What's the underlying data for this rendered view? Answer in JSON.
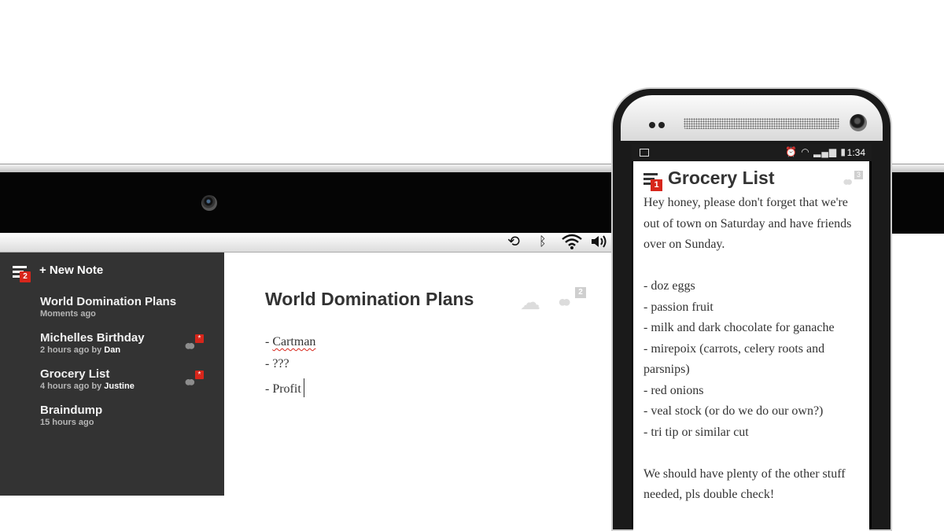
{
  "laptop": {
    "statusbar": {
      "icons": [
        "history-icon",
        "bluetooth-icon",
        "wifi-icon",
        "volume-icon"
      ]
    },
    "sidebar": {
      "unread_badge": "2",
      "new_note_label": "+ New Note",
      "notes": [
        {
          "title": "World Domination Plans",
          "meta": "Moments ago",
          "by": "",
          "name": "",
          "collab_badge": ""
        },
        {
          "title": "Michelles Birthday",
          "meta": "2 hours ago",
          "by": " by ",
          "name": "Dan",
          "collab_badge": "*"
        },
        {
          "title": "Grocery List",
          "meta": "4 hours ago",
          "by": " by ",
          "name": "Justine",
          "collab_badge": "*"
        },
        {
          "title": "Braindump",
          "meta": "15 hours ago",
          "by": "",
          "name": "",
          "collab_badge": ""
        }
      ]
    },
    "editor": {
      "title": "World Domination Plans",
      "share_count": "2",
      "lines": {
        "prefix": "- ",
        "l1": "Cartman",
        "l2": "- ???",
        "l3": "- Profit"
      }
    }
  },
  "phone": {
    "status": {
      "time": "1:34",
      "icons": [
        "image-icon",
        "alarm-icon",
        "wifi-icon",
        "signal-icon",
        "battery-icon"
      ]
    },
    "unread_badge": "1",
    "title": "Grocery List",
    "share_count": "3",
    "intro": "Hey honey, please don't forget that we're out of town on Saturday and have friends over on Sunday.",
    "items": [
      "- doz eggs",
      "- passion fruit",
      "- milk and dark chocolate for ganache",
      "- mirepoix (carrots, celery roots and parsnips)",
      "- red onions",
      "- veal stock (or do we do our own?)",
      "- tri tip or similar cut"
    ],
    "outro": "We should have plenty of the other stuff needed, pls double check!"
  },
  "colors": {
    "accent_red": "#d7261b",
    "sidebar_bg": "#333333",
    "text": "#333333"
  }
}
